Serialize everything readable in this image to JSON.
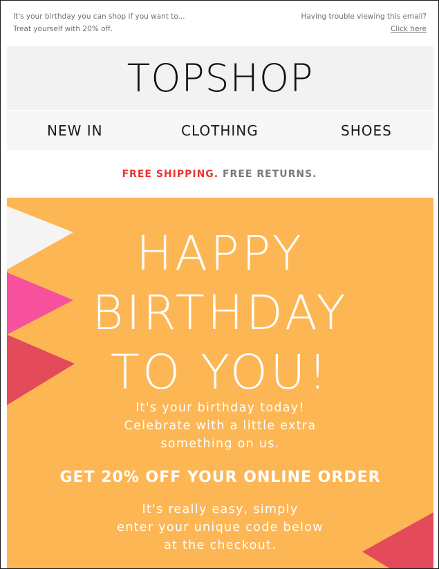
{
  "preheader": {
    "text": "It's your birthday you can shop if you want to... Treat yourself with 20% off.",
    "trouble_text": "Having trouble viewing this email?",
    "click_here": "Click here"
  },
  "brand": {
    "logo": "TOPSHOP"
  },
  "nav": {
    "items": [
      {
        "label": "NEW IN"
      },
      {
        "label": "CLOTHING"
      },
      {
        "label": "SHOES"
      }
    ]
  },
  "shipping": {
    "free_shipping": "FREE SHIPPING.",
    "free_returns": "FREE RETURNS."
  },
  "hero": {
    "headline": [
      "HAPPY",
      "BIRTHDAY",
      "TO YOU!"
    ],
    "intro": [
      "It's your birthday today!",
      "Celebrate with a little extra",
      "something on us."
    ],
    "offer": "GET 20% OFF YOUR ONLINE ORDER",
    "instructions": [
      "It's really easy, simply",
      "enter your unique code below",
      "at the checkout."
    ]
  },
  "colors": {
    "hero_background": "#fdb654",
    "accent_red": "#e8352f",
    "pennant_white": "#f4f4f4",
    "pennant_pink": "#f7509d",
    "pennant_red": "#e34a5a"
  }
}
